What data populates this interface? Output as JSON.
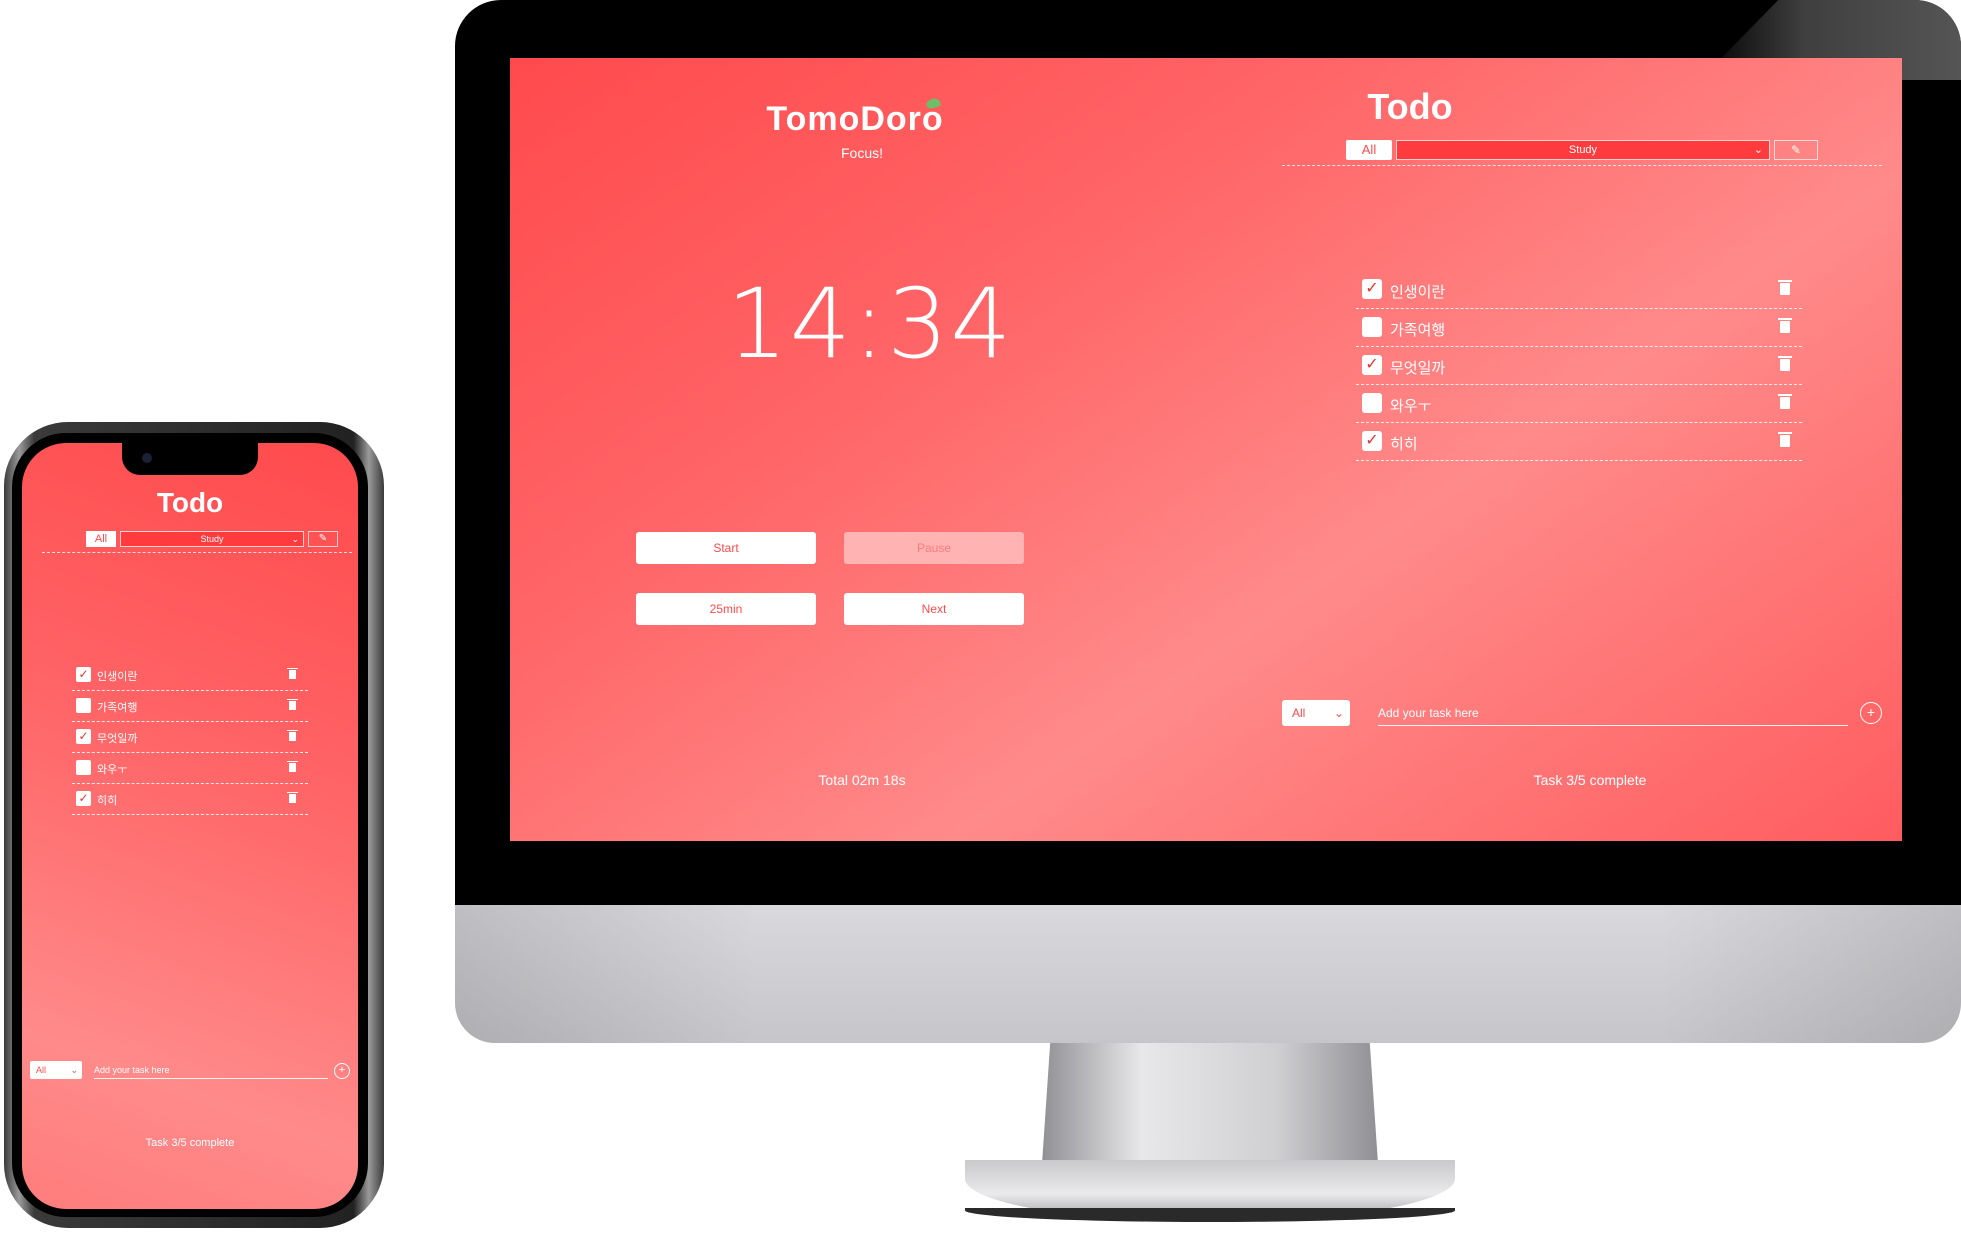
{
  "desktop": {
    "brand": {
      "title": "TomoDoro",
      "subtitle": "Focus!"
    },
    "timer": {
      "display": "14:34"
    },
    "buttons": {
      "start": "Start",
      "pause": "Pause",
      "duration": "25min",
      "next": "Next"
    },
    "total": "Total 02m 18s",
    "todo": {
      "title": "Todo",
      "filter_all": "All",
      "category_selected": "Study",
      "items": [
        {
          "label": "인생이란",
          "checked": true
        },
        {
          "label": "가족여행",
          "checked": false
        },
        {
          "label": "무엇일까",
          "checked": true
        },
        {
          "label": "와우ㅜ",
          "checked": false
        },
        {
          "label": "히히",
          "checked": true
        }
      ],
      "add_select_value": "All",
      "add_placeholder": "Add your task here",
      "task_count": "Task 3/5 complete"
    }
  },
  "phone": {
    "todo": {
      "title": "Todo",
      "filter_all": "All",
      "category_selected": "Study",
      "items": [
        {
          "label": "인생이란",
          "checked": true
        },
        {
          "label": "가족여행",
          "checked": false
        },
        {
          "label": "무엇일까",
          "checked": true
        },
        {
          "label": "와우ㅜ",
          "checked": false
        },
        {
          "label": "히히",
          "checked": true
        }
      ],
      "add_select_value": "All",
      "add_placeholder": "Add your task here",
      "task_count": "Task 3/5 complete"
    }
  },
  "icons": {
    "check": "checkmark-icon",
    "trash": "trash-icon",
    "edit": "pencil-icon",
    "add": "plus-icon",
    "dropdown": "chevron-down-icon"
  },
  "colors": {
    "accent": "#ff4a4d",
    "gradient_light": "#ff8a8a"
  }
}
